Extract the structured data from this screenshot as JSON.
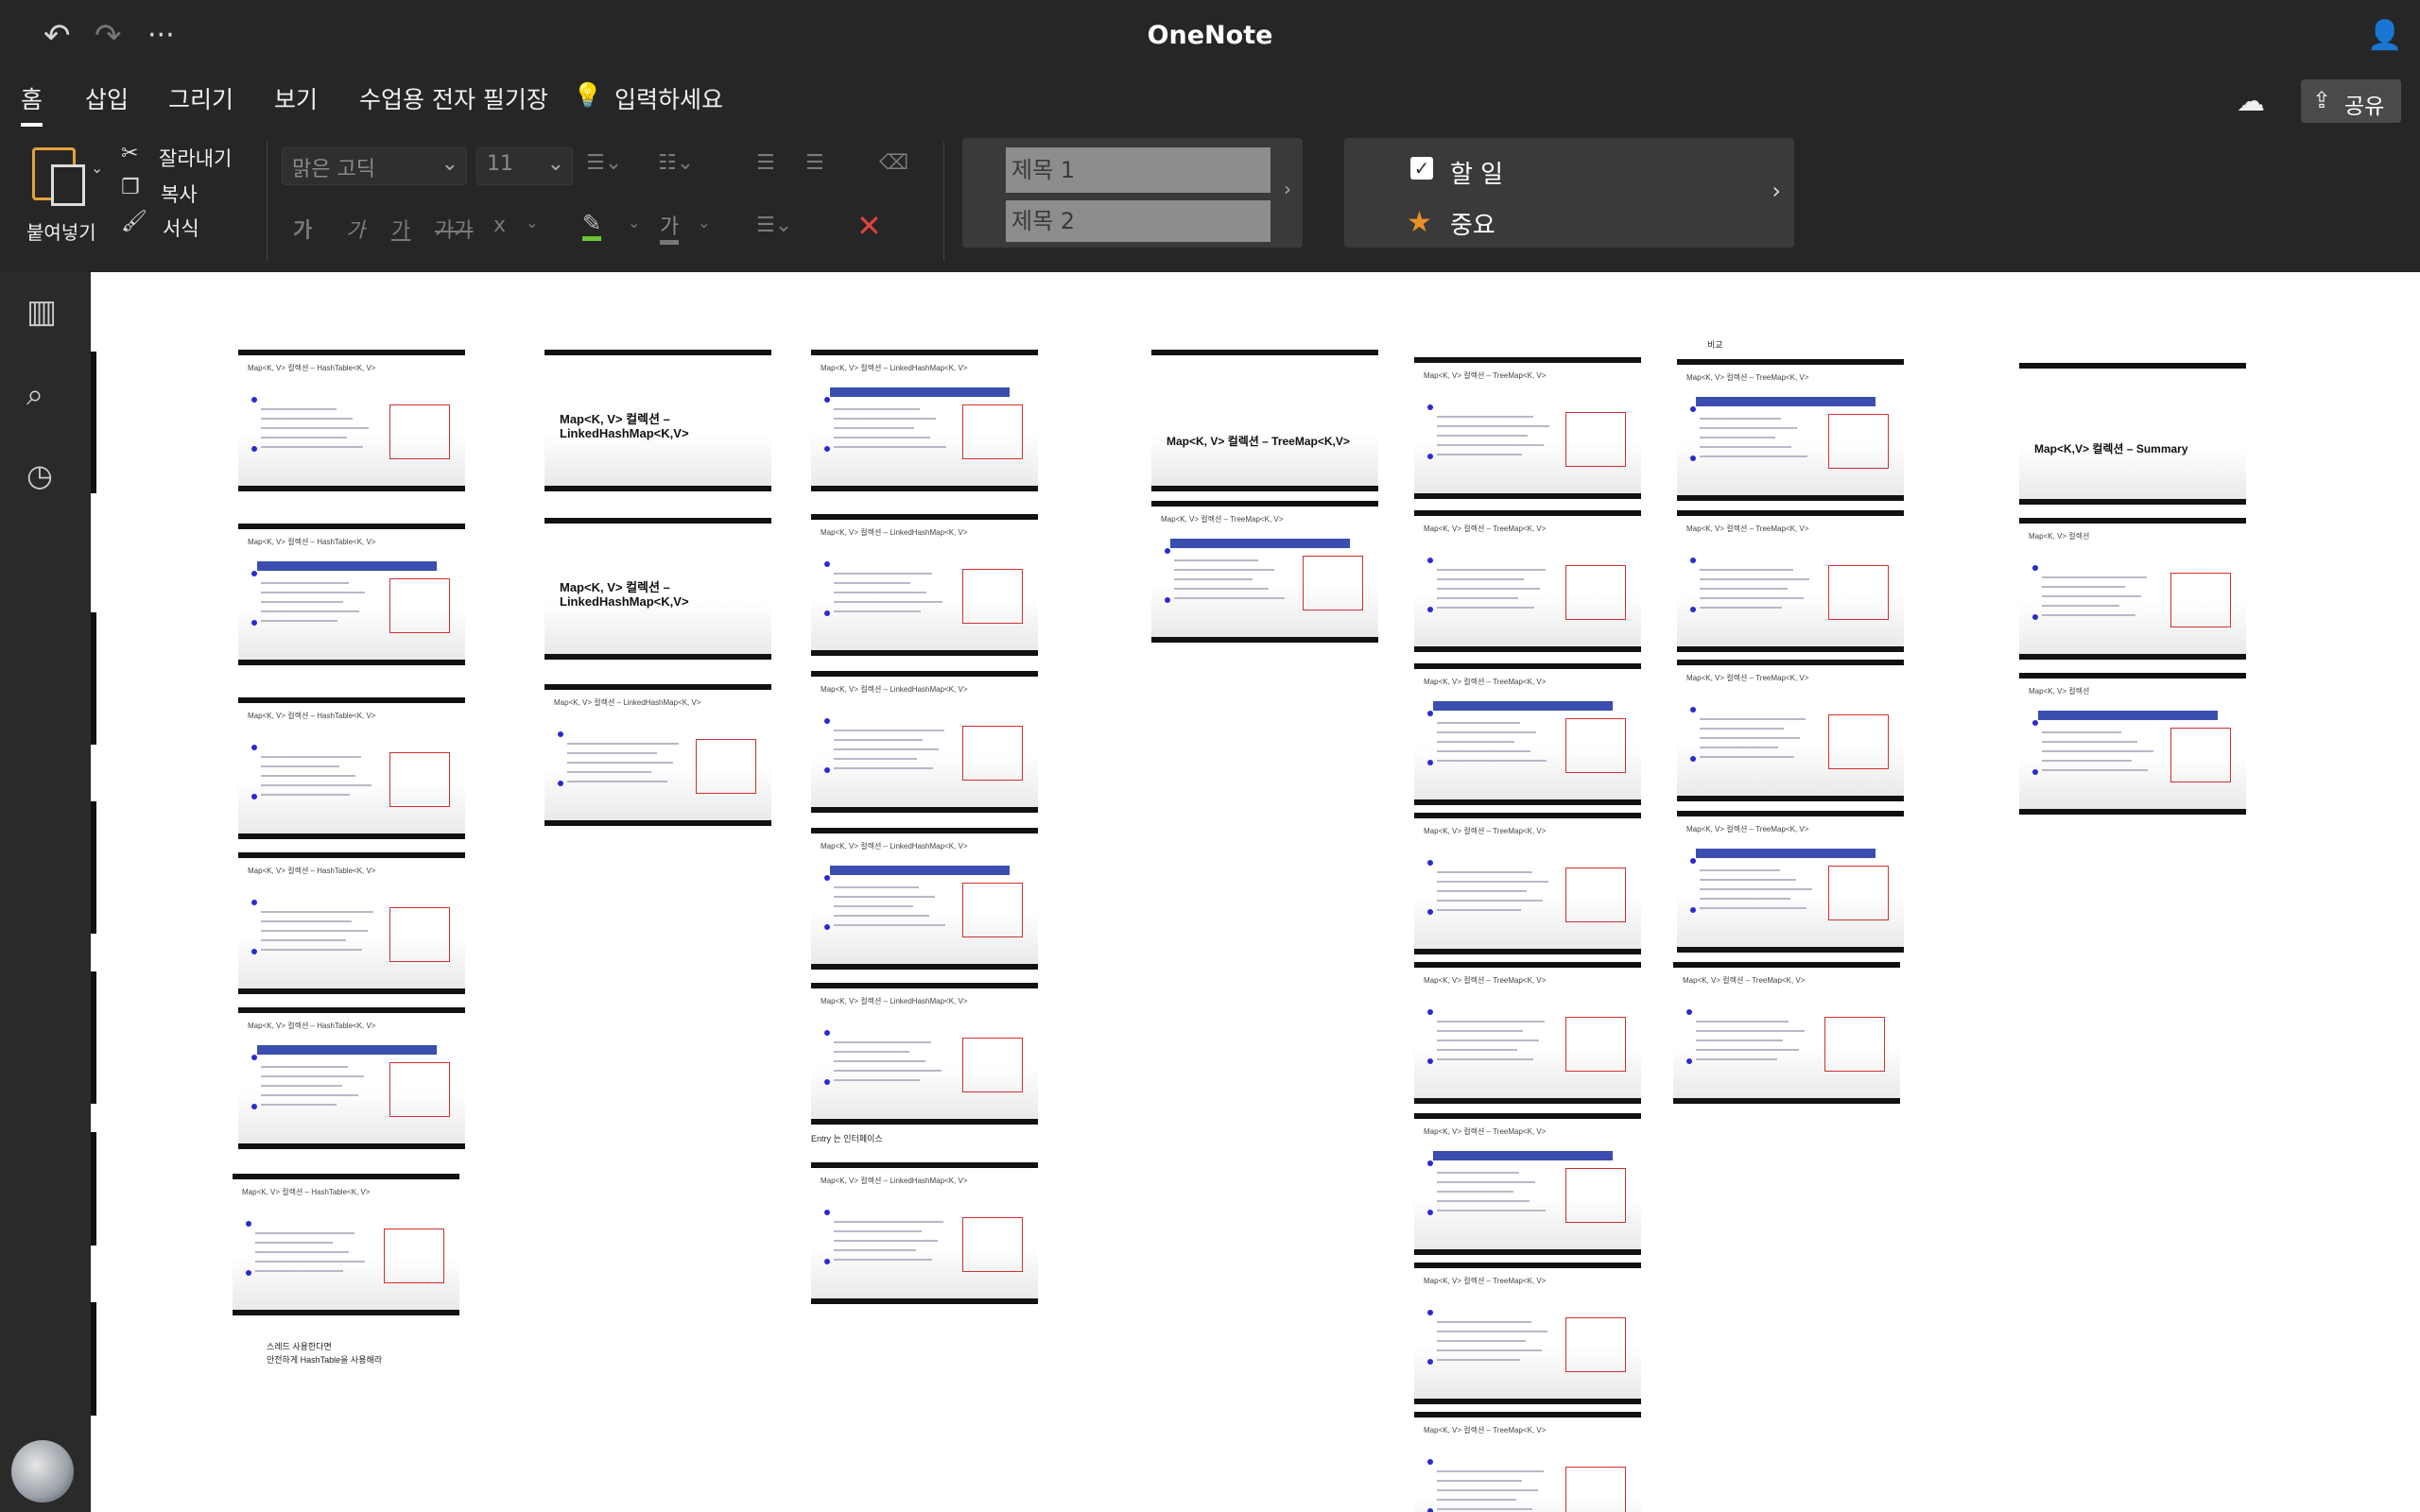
{
  "app": {
    "title": "OneNote"
  },
  "menu": {
    "tabs": [
      {
        "label": "홈"
      },
      {
        "label": "삽입"
      },
      {
        "label": "그리기"
      },
      {
        "label": "보기"
      },
      {
        "label": "수업용 전자 필기장"
      }
    ],
    "tell_me": "입력하세요",
    "share": "공유"
  },
  "ribbon": {
    "paste": "붙여넣기",
    "cut": "잘라내기",
    "copy": "복사",
    "format_painter": "서식",
    "font_name": "맑은 고딕",
    "font_size": "11",
    "bold": "가",
    "italic": "가",
    "underline": "가",
    "strike": "가가",
    "subscript": "x",
    "font_color": "가",
    "styles": [
      {
        "label": "제목 1"
      },
      {
        "label": "제목 2"
      }
    ],
    "tags": [
      {
        "label": "할 일"
      },
      {
        "label": "중요"
      }
    ]
  },
  "canvas": {
    "columns": [
      {
        "slides": [
          {
            "title": "Map<K, V> 컬렉션 – HashTable<K, V>"
          },
          {
            "title": "Map<K, V> 컬렉션 – HashTable<K, V>"
          },
          {
            "title": "Map<K, V> 컬렉션 – HashTable<K, V>"
          },
          {
            "title": "Map<K, V> 컬렉션 – HashTable<K, V>"
          },
          {
            "title": "Map<K, V> 컬렉션 – HashTable<K, V>"
          },
          {
            "title": "Map<K, V> 컬렉션 – HashTable<K, V>"
          }
        ],
        "note_line1": "스레드 사용한다면",
        "note_line2": "안전하게 HashTable을 사용해라"
      },
      {
        "cover1": "Map<K, V> 컬렉션 –\nLinkedHashMap<K,V>",
        "cover2": "Map<K, V> 컬렉션 –\nLinkedHashMap<K,V>",
        "slides": [
          {
            "title": "Map<K, V> 컬렉션 – LinkedHashMap<K, V>"
          }
        ]
      },
      {
        "slides": [
          {
            "title": "Map<K, V> 컬렉션 – LinkedHashMap<K, V>"
          },
          {
            "title": "Map<K, V> 컬렉션 – LinkedHashMap<K, V>"
          },
          {
            "title": "Map<K, V> 컬렉션 – LinkedHashMap<K, V>"
          },
          {
            "title": "Map<K, V> 컬렉션 – LinkedHashMap<K, V>"
          },
          {
            "title": "Map<K, V> 컬렉션 – LinkedHashMap<K, V>"
          },
          {
            "title": "Map<K, V> 컬렉션 – LinkedHashMap<K, V>"
          }
        ],
        "note": "Entry 는 인터페이스"
      },
      {
        "cover": "Map<K, V> 컬렉션 – TreeMap<K,V>",
        "slides": [
          {
            "title": "Map<K, V> 컬렉션 – TreeMap<K, V>"
          }
        ]
      },
      {
        "slides": [
          {
            "title": "Map<K, V> 컬렉션 – TreeMap<K, V>"
          },
          {
            "title": "Map<K, V> 컬렉션 – TreeMap<K, V>"
          },
          {
            "title": "Map<K, V> 컬렉션 – TreeMap<K, V>"
          },
          {
            "title": "Map<K, V> 컬렉션 – TreeMap<K, V>"
          },
          {
            "title": "Map<K, V> 컬렉션 – TreeMap<K, V>"
          },
          {
            "title": "Map<K, V> 컬렉션 – TreeMap<K, V>"
          },
          {
            "title": "Map<K, V> 컬렉션 – TreeMap<K, V>"
          },
          {
            "title": "Map<K, V> 컬렉션 – TreeMap<K, V>"
          }
        ]
      },
      {
        "note": "비교",
        "slides": [
          {
            "title": "Map<K, V> 컬렉션 – TreeMap<K, V>"
          },
          {
            "title": "Map<K, V> 컬렉션 – TreeMap<K, V>"
          },
          {
            "title": "Map<K, V> 컬렉션 – TreeMap<K, V>"
          },
          {
            "title": "Map<K, V> 컬렉션 – TreeMap<K, V>"
          },
          {
            "title": "Map<K, V> 컬렉션 – TreeMap<K, V>"
          }
        ]
      },
      {
        "cover": "Map<K,V> 컬렉션 – Summary",
        "slides": [
          {
            "title": "Map<K, V> 컬렉션"
          },
          {
            "title": "Map<K, V> 컬렉션"
          }
        ]
      }
    ]
  },
  "colors": {
    "chrome": "#262626",
    "rail": "#2a2a2a",
    "accent_red": "#d03030",
    "star": "#e8902a"
  }
}
